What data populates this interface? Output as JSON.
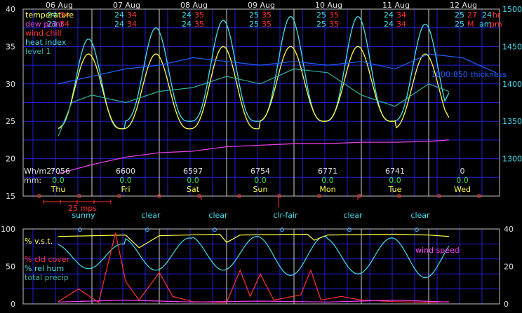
{
  "colors": {
    "grid": "#2020d8",
    "axis": "#c0c0c0",
    "label": "#e0e0e0",
    "temperature": "#ffff40",
    "dew_point": "#e040e0",
    "wind_chill": "#ff3030",
    "heat_index": "#40e0f0",
    "level1": "#30b0a0",
    "thickness": "#2060ff",
    "energy": "#e0e0e0",
    "precip": "#40e040",
    "day_name": "#ffff40",
    "sky": "#40e0f0",
    "pressure_red": "#ff3030",
    "wind_speed": "#ff40ff",
    "sun_marker": "#40b0ff"
  },
  "dates": [
    "06 Aug",
    "07 Aug",
    "08 Aug",
    "09 Aug",
    "10 Aug",
    "11 Aug",
    "12 Aug"
  ],
  "hilo": [
    {
      "tl": "24",
      "th": "34",
      "dl": "23",
      "dh": "34"
    },
    {
      "tl": "24",
      "th": "34",
      "dl": "24",
      "dh": "34"
    },
    {
      "tl": "24",
      "th": "35",
      "dl": "24",
      "dh": "35"
    },
    {
      "tl": "25",
      "th": "35",
      "dl": "25",
      "dh": "35"
    },
    {
      "tl": "25",
      "th": "35",
      "dl": "25",
      "dh": "35"
    },
    {
      "tl": "24",
      "th": "34",
      "dl": "24",
      "dh": "34"
    },
    {
      "tl": "25",
      "th": "27",
      "dl": "25",
      "dh": "M"
    }
  ],
  "top_right": {
    "hr": "24",
    "hr_unit": "hr",
    "am": "am",
    "pm": "pm"
  },
  "legend_top": {
    "temperature": "temperature",
    "dew_point": "dew point",
    "wind_chill": "wind chill",
    "heat_index": "heat index",
    "level1": "level 1"
  },
  "thickness_label": "1000:850 thickness",
  "energy": {
    "label": "Wh/m2:",
    "values": [
      "7056",
      "6600",
      "6597",
      "6754",
      "6771",
      "6741",
      "0"
    ]
  },
  "precip": {
    "label": "mm:",
    "values": [
      "0.0",
      "0.0",
      "0.0",
      "0.0",
      "0.0",
      "0.0",
      "0.0"
    ]
  },
  "days": [
    "Thu",
    "Fri",
    "Sat",
    "Sun",
    "Mon",
    "Tue",
    "Wed"
  ],
  "wind_scale_label": "25 mps",
  "sky": [
    "sunny",
    "clear",
    "clear",
    "clr-fair",
    "clear",
    "clear"
  ],
  "legend_bottom": {
    "vst": "% v.s.t.",
    "cld": "% cld cover",
    "rh": "% rel hum",
    "precip": "total precip",
    "wind": "wind speed"
  },
  "chart_data": [
    {
      "type": "line",
      "title": "",
      "x": [
        "06 Aug",
        "07 Aug",
        "08 Aug",
        "09 Aug",
        "10 Aug",
        "11 Aug",
        "12 Aug"
      ],
      "ylim": [
        15,
        40
      ],
      "y_ticks": [
        15,
        20,
        25,
        30,
        35,
        40
      ],
      "y2lim": [
        1250,
        1500
      ],
      "y2_ticks": [
        1300,
        1350,
        1400,
        1450,
        1500
      ],
      "series": [
        {
          "name": "temperature",
          "min": [
            24,
            24,
            24,
            25,
            25,
            24
          ],
          "max": [
            34,
            34,
            35,
            35,
            35,
            34
          ],
          "end": 25.5
        },
        {
          "name": "heat index",
          "min": [
            24,
            25,
            25,
            25,
            25,
            25
          ],
          "max": [
            36,
            37.5,
            38.5,
            39,
            39,
            38
          ],
          "end": 28.8
        },
        {
          "name": "level 1",
          "points": [
            [
              0,
              23
            ],
            [
              0.2,
              27.5
            ],
            [
              0.5,
              28.5
            ],
            [
              1.0,
              27.5
            ],
            [
              1.5,
              29
            ],
            [
              2.0,
              29.5
            ],
            [
              2.5,
              31
            ],
            [
              3.0,
              30
            ],
            [
              3.5,
              32
            ],
            [
              4.0,
              31.5
            ],
            [
              4.5,
              28.5
            ],
            [
              5.0,
              27
            ],
            [
              5.5,
              30
            ],
            [
              5.8,
              29
            ]
          ]
        },
        {
          "name": "dew point",
          "points": [
            [
              0,
              18
            ],
            [
              0.5,
              19.2
            ],
            [
              1.0,
              20.2
            ],
            [
              1.5,
              20.8
            ],
            [
              2.0,
              21.0
            ],
            [
              2.5,
              21.6
            ],
            [
              3.0,
              21.8
            ],
            [
              3.5,
              22.0
            ],
            [
              4.0,
              22.0
            ],
            [
              4.5,
              22.2
            ],
            [
              5.0,
              22.2
            ],
            [
              5.5,
              22.3
            ],
            [
              5.8,
              22.5
            ]
          ]
        },
        {
          "name": "1000:850 thickness",
          "axis": "right",
          "points": [
            [
              0,
              1400
            ],
            [
              0.5,
              1410
            ],
            [
              1.0,
              1420
            ],
            [
              1.5,
              1425
            ],
            [
              2.0,
              1435
            ],
            [
              2.5,
              1430
            ],
            [
              3.0,
              1425
            ],
            [
              3.5,
              1430
            ],
            [
              4.0,
              1425
            ],
            [
              4.5,
              1430
            ],
            [
              5.0,
              1420
            ],
            [
              5.5,
              1440
            ],
            [
              6.0,
              1435
            ],
            [
              6.5,
              1415
            ]
          ]
        }
      ]
    },
    {
      "type": "line",
      "title": "",
      "ylim": [
        0,
        100
      ],
      "y_ticks": [
        0,
        50,
        100
      ],
      "y2lim": [
        0,
        40
      ],
      "y2_ticks": [
        0,
        20,
        40
      ],
      "series": [
        {
          "name": "% v.s.t.",
          "points": [
            [
              0,
              90
            ],
            [
              1.0,
              92
            ],
            [
              1.2,
              75
            ],
            [
              1.5,
              91
            ],
            [
              2.4,
              93
            ],
            [
              2.5,
              82
            ],
            [
              2.7,
              92
            ],
            [
              3.7,
              93
            ],
            [
              3.8,
              85
            ],
            [
              4.0,
              92
            ],
            [
              5.0,
              93
            ],
            [
              5.5,
              92
            ],
            [
              5.8,
              90
            ]
          ]
        },
        {
          "name": "% rel hum",
          "min": [
            47,
            45,
            45,
            38,
            40,
            35
          ],
          "max": [
            80,
            88,
            90,
            90,
            88,
            88
          ]
        },
        {
          "name": "% cld cover",
          "points": [
            [
              0,
              3
            ],
            [
              0.3,
              20
            ],
            [
              0.6,
              2
            ],
            [
              0.85,
              95
            ],
            [
              1.0,
              30
            ],
            [
              1.2,
              5
            ],
            [
              1.5,
              42
            ],
            [
              1.7,
              10
            ],
            [
              2.0,
              3
            ],
            [
              2.5,
              2
            ],
            [
              2.7,
              45
            ],
            [
              2.85,
              10
            ],
            [
              3.0,
              40
            ],
            [
              3.2,
              5
            ],
            [
              3.6,
              12
            ],
            [
              3.75,
              45
            ],
            [
              3.9,
              5
            ],
            [
              4.2,
              10
            ],
            [
              4.5,
              5
            ],
            [
              5.0,
              3
            ],
            [
              5.5,
              2
            ],
            [
              5.8,
              3
            ]
          ]
        },
        {
          "name": "wind speed",
          "axis": "right",
          "points": [
            [
              0,
              1
            ],
            [
              1,
              2
            ],
            [
              2,
              1
            ],
            [
              3,
              1.5
            ],
            [
              4,
              1
            ],
            [
              5,
              2
            ],
            [
              5.8,
              1
            ]
          ]
        }
      ]
    }
  ]
}
